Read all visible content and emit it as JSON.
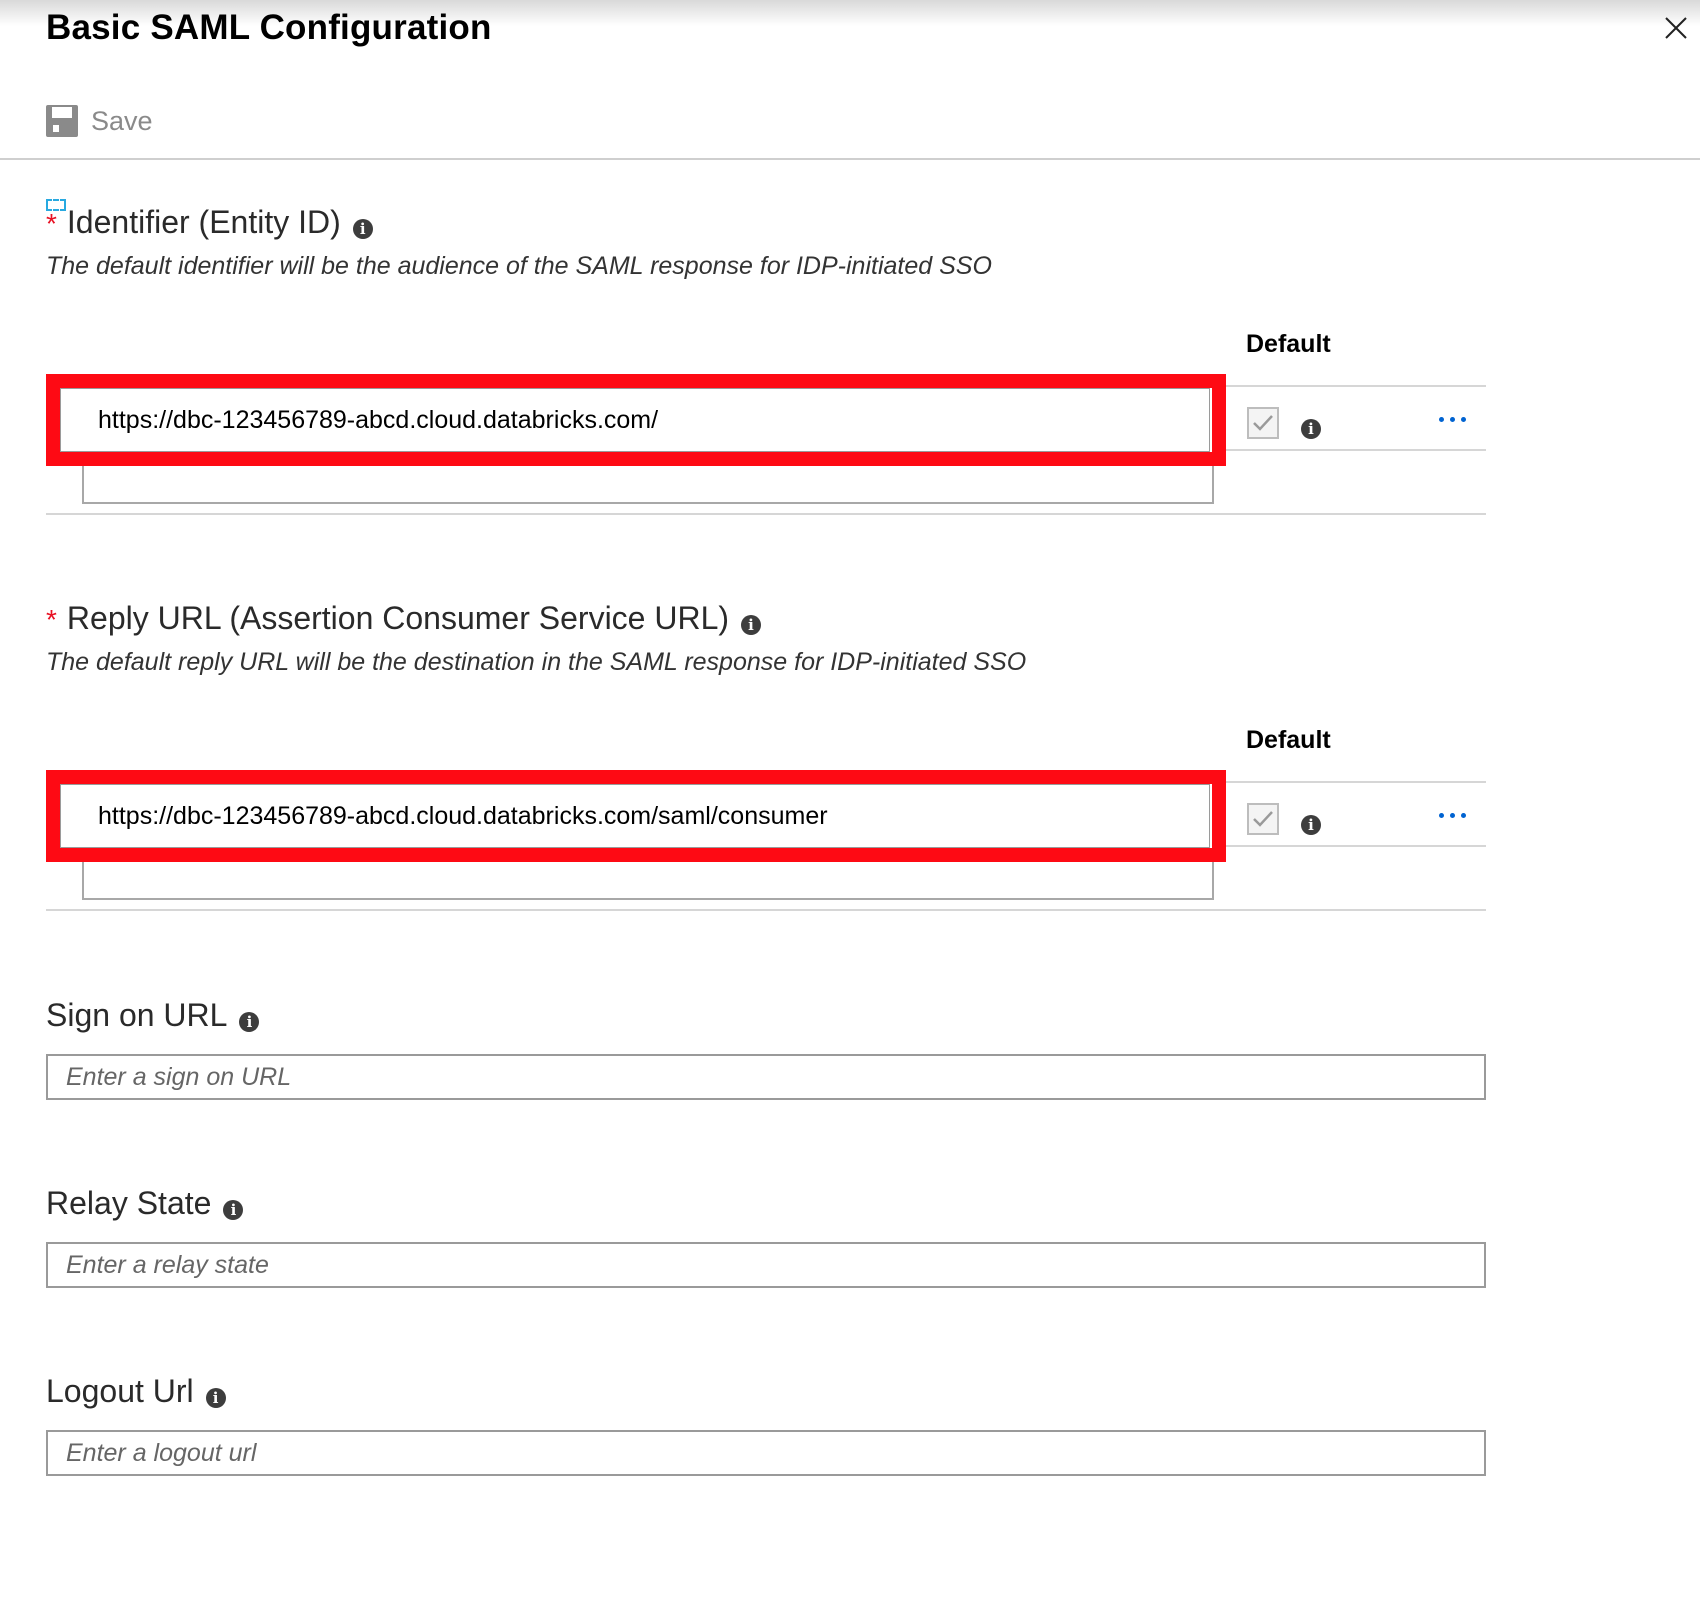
{
  "panel": {
    "title": "Basic SAML Configuration",
    "save_label": "Save"
  },
  "identifier": {
    "required_mark": "*",
    "label": "Identifier (Entity ID)",
    "info_glyph": "i",
    "description": "The default identifier will be the audience of the SAML response for IDP-initiated SSO",
    "default_header": "Default",
    "value": "https://dbc-123456789-abcd.cloud.databricks.com/",
    "default_checked": true
  },
  "reply_url": {
    "required_mark": "*",
    "label": "Reply URL (Assertion Consumer Service URL)",
    "info_glyph": "i",
    "description": "The default reply URL will be the destination in the SAML response for IDP-initiated SSO",
    "default_header": "Default",
    "value": "https://dbc-123456789-abcd.cloud.databricks.com/saml/consumer",
    "default_checked": true
  },
  "sign_on_url": {
    "label": "Sign on URL",
    "info_glyph": "i",
    "placeholder": "Enter a sign on URL"
  },
  "relay_state": {
    "label": "Relay State",
    "info_glyph": "i",
    "placeholder": "Enter a relay state"
  },
  "logout_url": {
    "label": "Logout Url",
    "info_glyph": "i",
    "placeholder": "Enter a logout url"
  },
  "colors": {
    "accent_blue": "#0063d1",
    "highlight_red": "#fe0a14",
    "required_red": "#e81123"
  },
  "icons": {
    "close": "close-icon",
    "save": "save-icon",
    "info": "info-icon",
    "more": "more-options-icon",
    "check": "checkmark-icon"
  }
}
